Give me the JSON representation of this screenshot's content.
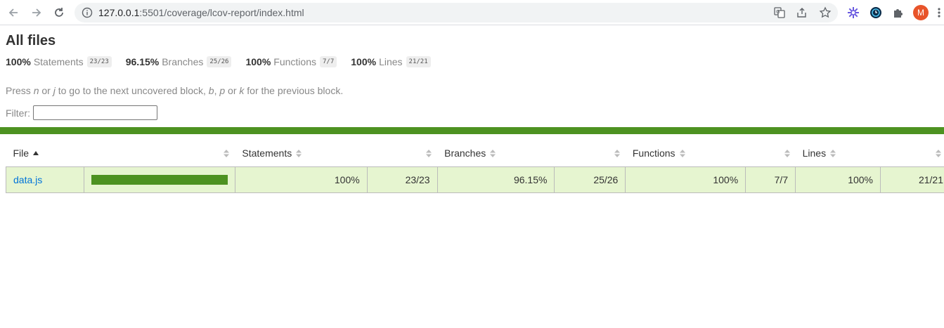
{
  "browser": {
    "url_host": "127.0.0.1",
    "url_path": ":5501/coverage/lcov-report/index.html",
    "avatar_letter": "M",
    "icons": [
      "back-arrow-icon",
      "forward-arrow-icon",
      "reload-icon",
      "info-icon",
      "translate-icon",
      "share-icon",
      "star-icon",
      "extension-flower-icon",
      "extension-clock-icon",
      "puzzle-icon",
      "menu-dots-icon"
    ]
  },
  "page": {
    "title": "All files",
    "summary": [
      {
        "pct": "100%",
        "label": "Statements",
        "fraction": "23/23"
      },
      {
        "pct": "96.15%",
        "label": "Branches",
        "fraction": "25/26"
      },
      {
        "pct": "100%",
        "label": "Functions",
        "fraction": "7/7"
      },
      {
        "pct": "100%",
        "label": "Lines",
        "fraction": "21/21"
      }
    ],
    "hint": {
      "p1": "Press ",
      "k1": "n",
      "p2": " or ",
      "k2": "j",
      "p3": " to go to the next uncovered block, ",
      "k3": "b",
      "p4": ", ",
      "k4": "p",
      "p5": " or ",
      "k5": "k",
      "p6": " for the previous block."
    },
    "filter_label": "Filter:",
    "filter_value": "",
    "status_color": "#4d9221"
  },
  "table": {
    "headers": {
      "file": "File",
      "statements": "Statements",
      "branches": "Branches",
      "functions": "Functions",
      "lines": "Lines"
    },
    "rows": [
      {
        "file": "data.js",
        "coverage_fraction": 1.0,
        "statements_pct": "100%",
        "statements_frac": "23/23",
        "branches_pct": "96.15%",
        "branches_frac": "25/26",
        "functions_pct": "100%",
        "functions_frac": "7/7",
        "lines_pct": "100%",
        "lines_frac": "21/21"
      }
    ]
  }
}
